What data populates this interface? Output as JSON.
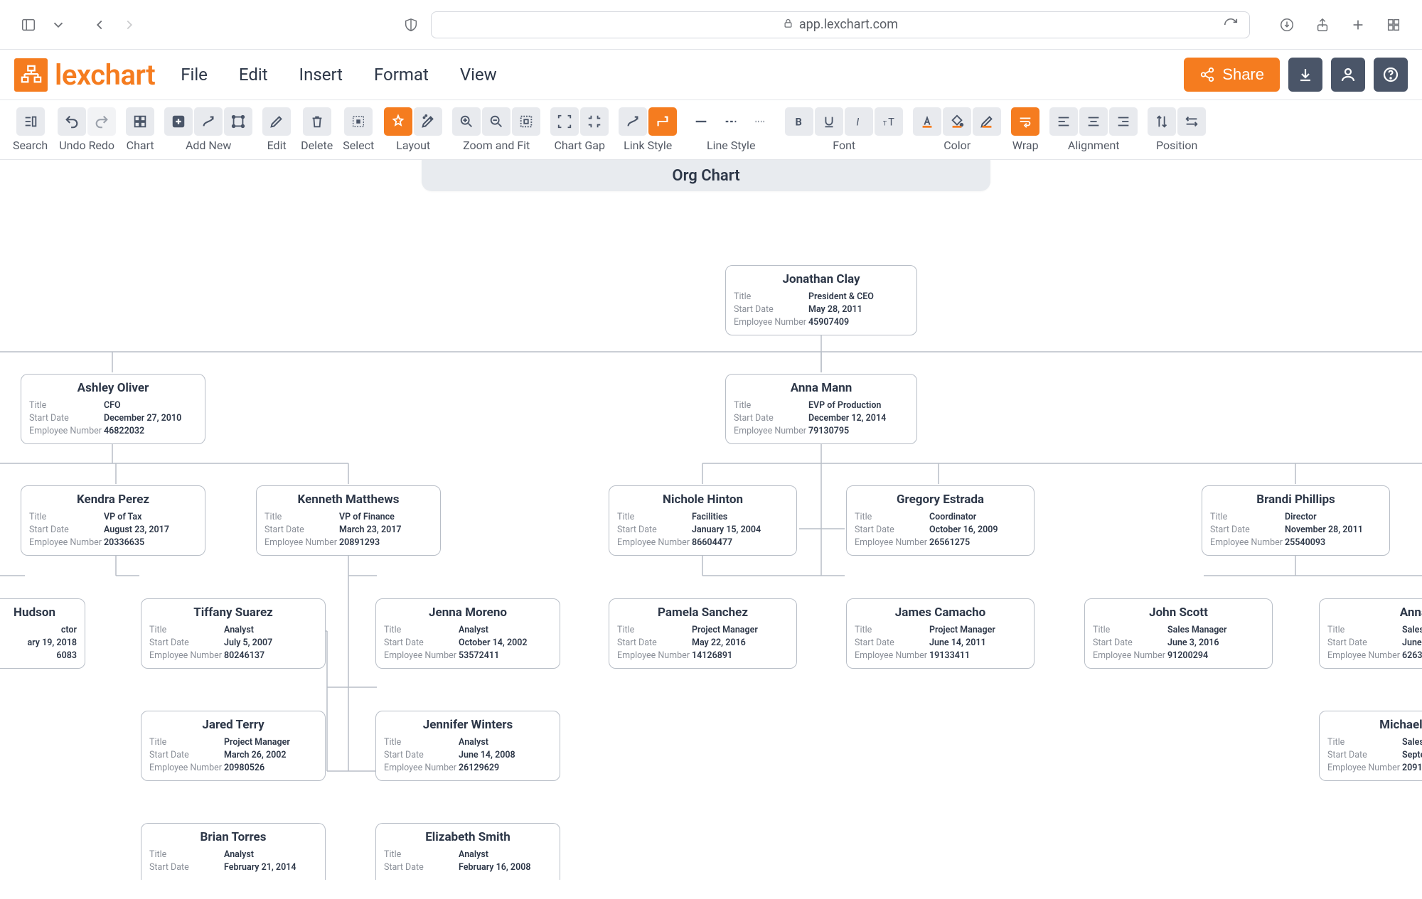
{
  "browser": {
    "url": "app.lexchart.com"
  },
  "brand": {
    "name": "lexchart"
  },
  "menu": {
    "file": "File",
    "edit": "Edit",
    "insert": "Insert",
    "format": "Format",
    "view": "View"
  },
  "header": {
    "share": "Share"
  },
  "toolbar": {
    "search": "Search",
    "undo": "Undo",
    "redo": "Redo",
    "chart": "Chart",
    "add_new": "Add New",
    "edit": "Edit",
    "delete": "Delete",
    "select": "Select",
    "layout": "Layout",
    "zoom_fit": "Zoom and Fit",
    "chart_gap": "Chart Gap",
    "link_style": "Link Style",
    "line_style": "Line Style",
    "font": "Font",
    "color": "Color",
    "wrap": "Wrap",
    "alignment": "Alignment",
    "position": "Position"
  },
  "canvas": {
    "title": "Org Chart",
    "field_labels": {
      "title": "Title",
      "start": "Start Date",
      "emp": "Employee Number"
    },
    "nodes": {
      "clay": {
        "name": "Jonathan Clay",
        "title": "President & CEO",
        "start": "May 28, 2011",
        "emp": "45907409"
      },
      "oliver": {
        "name": "Ashley Oliver",
        "title": "CFO",
        "start": "December 27, 2010",
        "emp": "46822032"
      },
      "mann": {
        "name": "Anna Mann",
        "title": "EVP of Production",
        "start": "December 12, 2014",
        "emp": "79130795"
      },
      "perez": {
        "name": "Kendra Perez",
        "title": "VP of Tax",
        "start": "August 23, 2017",
        "emp": "20336635"
      },
      "matthews": {
        "name": "Kenneth Matthews",
        "title": "VP of Finance",
        "start": "March 23, 2017",
        "emp": "20891293"
      },
      "hinton": {
        "name": "Nichole Hinton",
        "title": "Facilities",
        "start": "January 15, 2004",
        "emp": "86604477"
      },
      "estrada": {
        "name": "Gregory Estrada",
        "title": "Coordinator",
        "start": "October 16, 2009",
        "emp": "26561275"
      },
      "phillips": {
        "name": "Brandi Phillips",
        "title": "Director",
        "start": "November 28, 2011",
        "emp": "25540093"
      },
      "hudson": {
        "name": "Hudson",
        "title": "ctor",
        "start": "ary 19, 2018",
        "emp": "6083"
      },
      "suarez": {
        "name": "Tiffany Suarez",
        "title": "Analyst",
        "start": "July 5, 2007",
        "emp": "80246137"
      },
      "moreno": {
        "name": "Jenna Moreno",
        "title": "Analyst",
        "start": "October 14, 2002",
        "emp": "53572411"
      },
      "sanchez": {
        "name": "Pamela Sanchez",
        "title": "Project Manager",
        "start": "May 22, 2016",
        "emp": "14126891"
      },
      "camacho": {
        "name": "James Camacho",
        "title": "Project Manager",
        "start": "June 14, 2011",
        "emp": "19133411"
      },
      "scott": {
        "name": "John Scott",
        "title": "Sales Manager",
        "start": "June 3, 2016",
        "emp": "91200294"
      },
      "annao": {
        "name": "Anna O",
        "title": "Sales",
        "start": "June",
        "emp": "6263"
      },
      "terry": {
        "name": "Jared Terry",
        "title": "Project Manager",
        "start": "March 26, 2002",
        "emp": "20980526"
      },
      "winters": {
        "name": "Jennifer Winters",
        "title": "Analyst",
        "start": "June 14, 2008",
        "emp": "26129629"
      },
      "torres": {
        "name": "Brian Torres",
        "title": "Analyst",
        "start": "February 21, 2014"
      },
      "smith": {
        "name": "Elizabeth Smith",
        "title": "Analyst",
        "start": "February 16, 2008"
      },
      "michael": {
        "name": "Michael Jo",
        "title": "Sales",
        "start": "Septe",
        "emp": "2091"
      }
    }
  }
}
